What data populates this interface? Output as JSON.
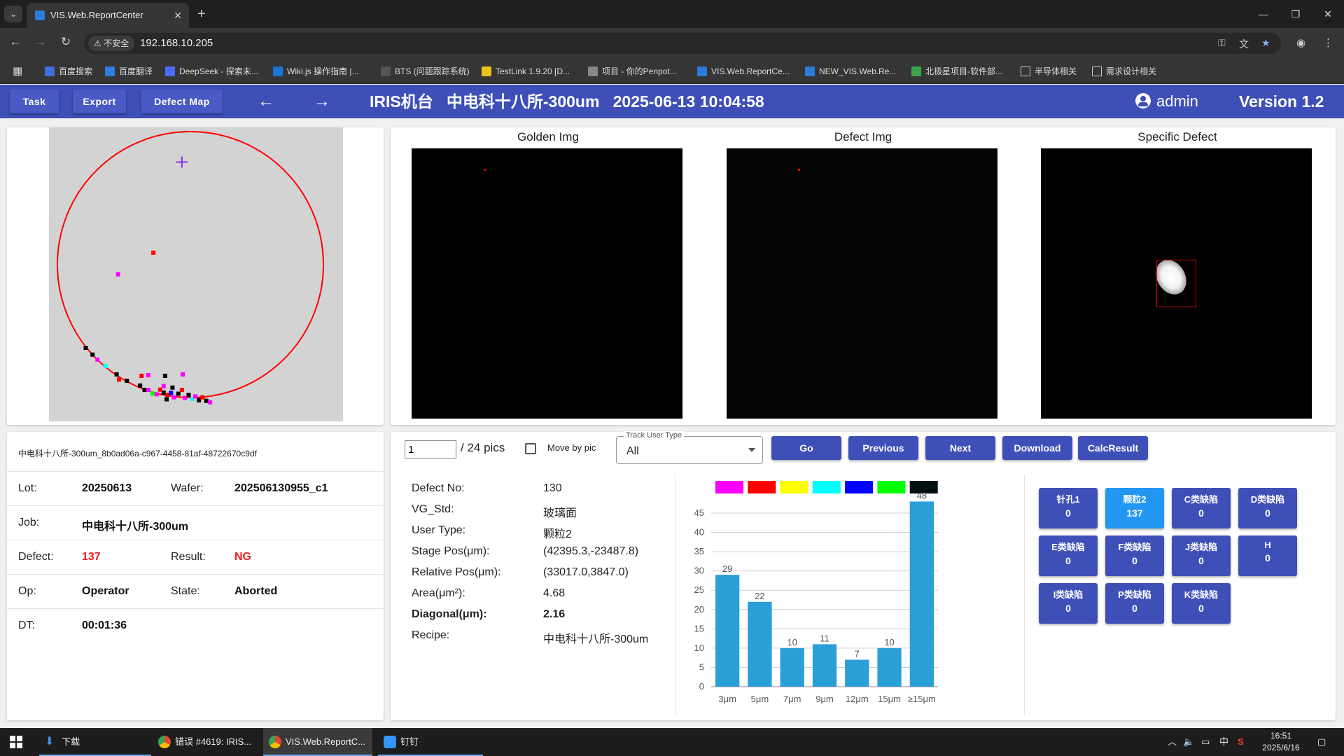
{
  "browser": {
    "tab_title": "VIS.Web.ReportCenter",
    "url": "192.168.10.205",
    "insecure_label": "不安全",
    "bookmarks": [
      "百度搜索",
      "百度翻译",
      "DeepSeek - 探索未...",
      "Wiki.js 操作指南 |...",
      "BTS (问题跟踪系统)",
      "TestLink 1.9.20 [D...",
      "项目 - 你的Penpot...",
      "VIS.Web.ReportCe...",
      "NEW_VIS.Web.Re...",
      "北极星项目-软件部...",
      "半导体相关",
      "需求设计相关"
    ]
  },
  "header": {
    "task_label": "Task",
    "export_label": "Export",
    "defect_map_label": "Defect Map",
    "title": "IRIS机台   中电科十八所-300um   2025-06-13 10:04:58",
    "user": "admin",
    "version": "Version 1.2"
  },
  "images": {
    "golden_caption": "Golden Img",
    "defect_caption": "Defect Img",
    "specific_caption": "Specific Defect"
  },
  "wafer_map": {
    "points": [
      {
        "x": 0.355,
        "y": 0.426,
        "color": "#ff0000"
      },
      {
        "x": 0.235,
        "y": 0.5,
        "color": "#ff00ff"
      },
      {
        "x": 0.125,
        "y": 0.75,
        "color": "#000000"
      },
      {
        "x": 0.148,
        "y": 0.773,
        "color": "#000000"
      },
      {
        "x": 0.165,
        "y": 0.79,
        "color": "#ff00ff"
      },
      {
        "x": 0.192,
        "y": 0.812,
        "color": "#00ffff"
      },
      {
        "x": 0.23,
        "y": 0.84,
        "color": "#000000"
      },
      {
        "x": 0.238,
        "y": 0.858,
        "color": "#ff0000"
      },
      {
        "x": 0.265,
        "y": 0.862,
        "color": "#000000"
      },
      {
        "x": 0.315,
        "y": 0.845,
        "color": "#ff0000"
      },
      {
        "x": 0.338,
        "y": 0.843,
        "color": "#ff00ff"
      },
      {
        "x": 0.395,
        "y": 0.845,
        "color": "#000000"
      },
      {
        "x": 0.455,
        "y": 0.84,
        "color": "#ff00ff"
      },
      {
        "x": 0.31,
        "y": 0.878,
        "color": "#000000"
      },
      {
        "x": 0.325,
        "y": 0.893,
        "color": "#000000"
      },
      {
        "x": 0.338,
        "y": 0.893,
        "color": "#ff00ff"
      },
      {
        "x": 0.352,
        "y": 0.905,
        "color": "#00ff00"
      },
      {
        "x": 0.366,
        "y": 0.908,
        "color": "#ff00ff"
      },
      {
        "x": 0.378,
        "y": 0.892,
        "color": "#ff0000"
      },
      {
        "x": 0.39,
        "y": 0.902,
        "color": "#000000"
      },
      {
        "x": 0.403,
        "y": 0.91,
        "color": "#ff0000"
      },
      {
        "x": 0.415,
        "y": 0.903,
        "color": "#0000ff"
      },
      {
        "x": 0.425,
        "y": 0.918,
        "color": "#ff00ff"
      },
      {
        "x": 0.44,
        "y": 0.906,
        "color": "#000000"
      },
      {
        "x": 0.452,
        "y": 0.893,
        "color": "#ff0000"
      },
      {
        "x": 0.462,
        "y": 0.92,
        "color": "#ff00ff"
      },
      {
        "x": 0.475,
        "y": 0.91,
        "color": "#000000"
      },
      {
        "x": 0.487,
        "y": 0.924,
        "color": "#00ffff"
      },
      {
        "x": 0.498,
        "y": 0.915,
        "color": "#ff00ff"
      },
      {
        "x": 0.51,
        "y": 0.928,
        "color": "#000000"
      },
      {
        "x": 0.522,
        "y": 0.918,
        "color": "#ff0000"
      },
      {
        "x": 0.535,
        "y": 0.93,
        "color": "#000000"
      },
      {
        "x": 0.548,
        "y": 0.935,
        "color": "#ff00ff"
      },
      {
        "x": 0.39,
        "y": 0.88,
        "color": "#ff00ff"
      },
      {
        "x": 0.42,
        "y": 0.885,
        "color": "#000000"
      },
      {
        "x": 0.4,
        "y": 0.925,
        "color": "#000000"
      }
    ],
    "marker": {
      "x": 0.452,
      "y": 0.118,
      "color": "#8a2be2"
    },
    "circle_color": "#ff0000"
  },
  "info": {
    "identifier": "中电科十八所-300um_8b0ad06a-c967-4458-81af-48722670c9df",
    "lot_label": "Lot:",
    "lot": "20250613",
    "wafer_label": "Wafer:",
    "wafer": "202506130955_c1",
    "job_label": "Job:",
    "job": "中电科十八所-300um",
    "defect_label": "Defect:",
    "defect": "137",
    "result_label": "Result:",
    "result": "NG",
    "op_label": "Op:",
    "op": "Operator",
    "state_label": "State:",
    "state": "Aborted",
    "dt_label": "DT:",
    "dt": "00:01:36"
  },
  "nav": {
    "pic_value": "1",
    "pic_total": "/ 24 pics",
    "move_by_pic": "Move by pic",
    "track_label": "Track User Type",
    "track_value": "All",
    "go": "Go",
    "previous": "Previous",
    "next": "Next",
    "download": "Download",
    "calc": "CalcResult"
  },
  "details": [
    {
      "label": "Defect No:",
      "value": "130",
      "bold": false
    },
    {
      "label": "VG_Std:",
      "value": "玻璃面",
      "bold": false
    },
    {
      "label": "User Type:",
      "value": "颗粒2",
      "bold": false
    },
    {
      "label": "Stage Pos(μm):",
      "value": "(42395.3,-23487.8)",
      "bold": false
    },
    {
      "label": "Relative Pos(μm):",
      "value": "(33017.0,3847.0)",
      "bold": false
    },
    {
      "label": "Area(μm²):",
      "value": "4.68",
      "bold": false
    },
    {
      "label": "Diagonal(μm):",
      "value": "2.16",
      "bold": true
    },
    {
      "label": "Recipe:",
      "value": "中电科十八所-300um",
      "bold": false
    }
  ],
  "chart_data": {
    "type": "bar",
    "categories": [
      "3μm",
      "5μm",
      "7μm",
      "9μm",
      "12μm",
      "15μm",
      "≥15μm"
    ],
    "values": [
      29,
      22,
      10,
      11,
      7,
      10,
      48
    ],
    "ylim": [
      0,
      45
    ],
    "yticks": [
      0,
      5,
      10,
      15,
      20,
      25,
      30,
      35,
      40,
      45
    ],
    "bar_color": "#2a9fd8",
    "legend_colors": [
      "#ff00ff",
      "#ff0000",
      "#ffff00",
      "#00ffff",
      "#0000ff",
      "#00ff00",
      "#001010"
    ],
    "grid": true
  },
  "defect_types": [
    {
      "name": "针孔1",
      "count": "0",
      "active": false
    },
    {
      "name": "颗粒2",
      "count": "137",
      "active": true
    },
    {
      "name": "C类缺陷",
      "count": "0",
      "active": false
    },
    {
      "name": "D类缺陷",
      "count": "0",
      "active": false
    },
    {
      "name": "E类缺陷",
      "count": "0",
      "active": false
    },
    {
      "name": "F类缺陷",
      "count": "0",
      "active": false
    },
    {
      "name": "J类缺陷",
      "count": "0",
      "active": false
    },
    {
      "name": "H",
      "count": "0",
      "active": false
    },
    {
      "name": "I类缺陷",
      "count": "0",
      "active": false
    },
    {
      "name": "P类缺陷",
      "count": "0",
      "active": false
    },
    {
      "name": "K类缺陷",
      "count": "0",
      "active": false
    }
  ],
  "taskbar": {
    "items": [
      "下载",
      "错误 #4619: IRIS...",
      "VIS.Web.ReportC...",
      "钉钉"
    ],
    "ime": "中",
    "time": "16:51",
    "date": "2025/6/16"
  }
}
